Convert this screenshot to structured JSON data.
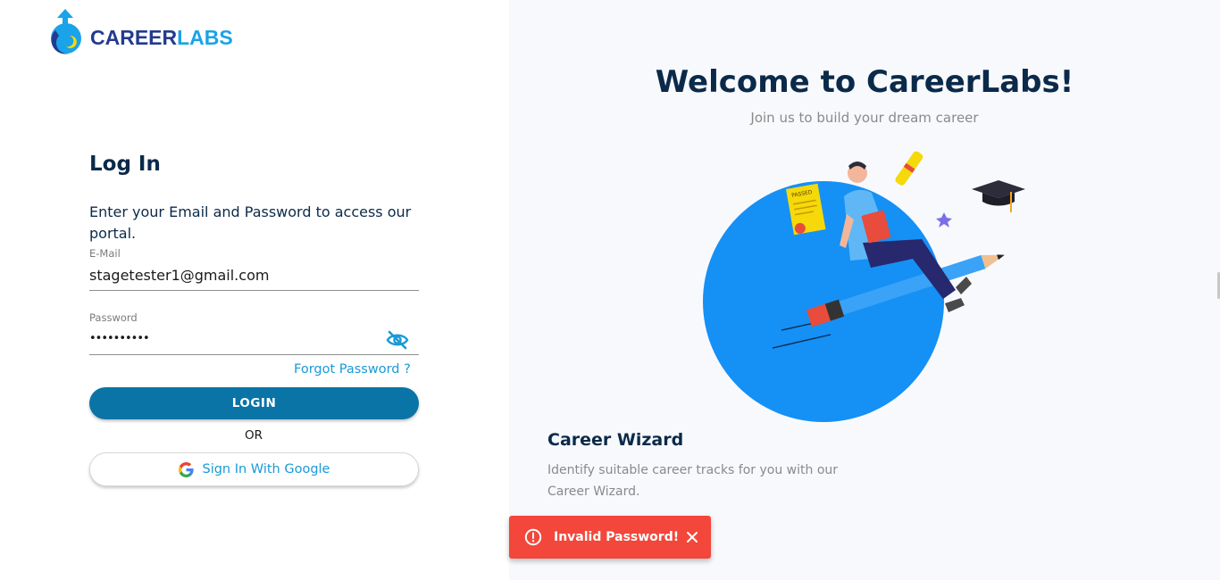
{
  "brand": {
    "name_part1": "CAREER",
    "name_part2": "LABS"
  },
  "login": {
    "title": "Log In",
    "description": "Enter your Email and Password to access our portal.",
    "email_label": "E-Mail",
    "email_value": "stagetester1@gmail.com",
    "password_label": "Password",
    "password_value": "••••••••••",
    "forgot_label": "Forgot Password ?",
    "login_button": "LOGIN",
    "or_label": "OR",
    "google_button": "Sign In With Google"
  },
  "hero": {
    "title": "Welcome to CareerLabs!",
    "tagline": "Join us to build your dream career",
    "feature_title": "Career Wizard",
    "feature_desc": "Identify suitable career tracks for you with our Career Wizard.",
    "passed_stamp": "PASSED"
  },
  "toast": {
    "message": "Invalid Password!"
  },
  "colors": {
    "primary": "#0a74a6",
    "link": "#1a9ad6",
    "heading": "#0b2a4a",
    "error": "#f2473a",
    "illustration_circle": "#1590f5"
  },
  "icons": {
    "logo": "careerlabs-logo-icon",
    "eye": "eye-slash-icon",
    "google": "google-icon",
    "toast": "alert-circle-icon",
    "close": "close-icon"
  }
}
